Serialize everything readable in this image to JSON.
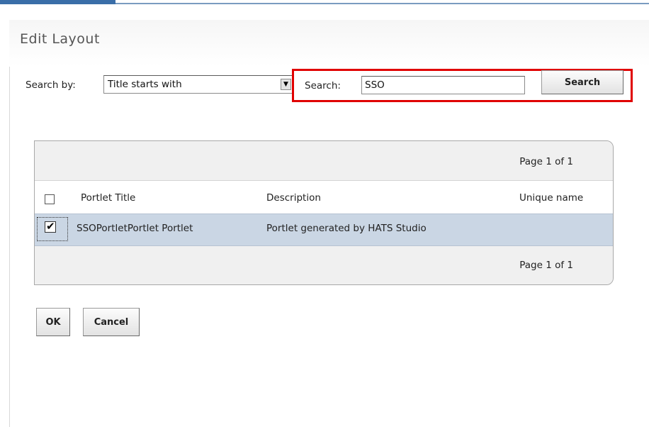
{
  "page": {
    "title": "Edit Layout"
  },
  "search": {
    "search_by_label": "Search by:",
    "search_by_selected": "Title starts with",
    "search_label": "Search:",
    "search_value": "SSO",
    "search_button_label": "Search"
  },
  "table": {
    "pager_top": "Page 1 of 1",
    "pager_bottom": "Page 1 of 1",
    "columns": [
      "Portlet Title",
      "Description",
      "Unique name"
    ],
    "header_checkbox_checked": false,
    "rows": [
      {
        "checked": true,
        "title": "SSOPortletPortlet Portlet",
        "description": "Portlet generated by HATS Studio",
        "unique_name": ""
      }
    ]
  },
  "actions": {
    "ok_label": "OK",
    "cancel_label": "Cancel"
  },
  "colors": {
    "highlight": "#e00000",
    "selected_row": "#cad6e4",
    "accent": "#3a6ea8"
  },
  "icons": {
    "dropdown": "chevron-down-icon",
    "checkmark": "checkmark-icon"
  }
}
